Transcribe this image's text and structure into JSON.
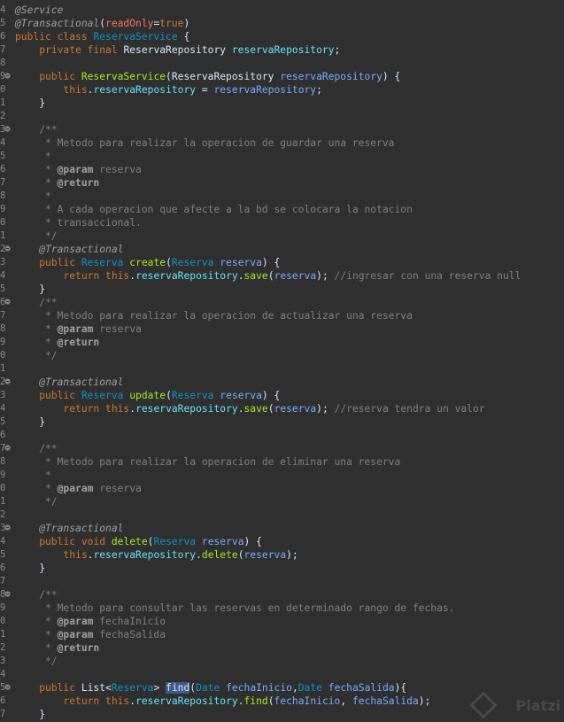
{
  "editor": {
    "lines": [
      {
        "ln": "4",
        "fold": false,
        "tokens": [
          [
            "ann",
            "@Service"
          ]
        ]
      },
      {
        "ln": "5",
        "fold": false,
        "tokens": [
          [
            "ann",
            "@Transactional"
          ],
          [
            "cls",
            "("
          ],
          [
            "pink",
            "readOnly"
          ],
          [
            "cls",
            "="
          ],
          [
            "kw",
            "true"
          ],
          [
            "cls",
            ")"
          ]
        ]
      },
      {
        "ln": "6",
        "fold": false,
        "tokens": [
          [
            "kw",
            "public class "
          ],
          [
            "type",
            "ReservaService"
          ],
          [
            "cls",
            " {"
          ]
        ]
      },
      {
        "ln": "7",
        "fold": false,
        "tokens": [
          [
            "cls",
            "    "
          ],
          [
            "kw",
            "private final "
          ],
          [
            "cls",
            "ReservaRepository "
          ],
          [
            "field",
            "reservaRepository"
          ],
          [
            "cls",
            ";"
          ]
        ]
      },
      {
        "ln": "8",
        "fold": false,
        "tokens": []
      },
      {
        "ln": "9",
        "fold": true,
        "tokens": [
          [
            "cls",
            "    "
          ],
          [
            "kw",
            "public "
          ],
          [
            "method",
            "ReservaService"
          ],
          [
            "cls",
            "(ReservaRepository "
          ],
          [
            "param",
            "reservaRepository"
          ],
          [
            "cls",
            ") {"
          ]
        ]
      },
      {
        "ln": "0",
        "fold": false,
        "tokens": [
          [
            "cls",
            "        "
          ],
          [
            "this",
            "this"
          ],
          [
            "cls",
            "."
          ],
          [
            "field",
            "reservaRepository"
          ],
          [
            "cls",
            " = "
          ],
          [
            "param",
            "reservaRepository"
          ],
          [
            "cls",
            ";"
          ]
        ]
      },
      {
        "ln": "1",
        "fold": false,
        "tokens": [
          [
            "cls",
            "    }"
          ]
        ]
      },
      {
        "ln": "2",
        "fold": false,
        "tokens": []
      },
      {
        "ln": "3",
        "fold": true,
        "tokens": [
          [
            "cmt",
            "    /**"
          ]
        ]
      },
      {
        "ln": "4",
        "fold": false,
        "tokens": [
          [
            "cmt",
            "     * Metodo para realizar la operacion de guardar una reserva"
          ]
        ]
      },
      {
        "ln": "5",
        "fold": false,
        "tokens": [
          [
            "cmt",
            "     *"
          ]
        ]
      },
      {
        "ln": "6",
        "fold": false,
        "tokens": [
          [
            "cmt",
            "     * "
          ],
          [
            "jdtag",
            "@param"
          ],
          [
            "cmt",
            " reserva"
          ]
        ]
      },
      {
        "ln": "7",
        "fold": false,
        "tokens": [
          [
            "cmt",
            "     * "
          ],
          [
            "jdtag",
            "@return"
          ]
        ]
      },
      {
        "ln": "8",
        "fold": false,
        "tokens": [
          [
            "cmt",
            "     *"
          ]
        ]
      },
      {
        "ln": "9",
        "fold": false,
        "tokens": [
          [
            "cmt",
            "     * A cada operacion que afecte a la bd se colocara la notacion"
          ]
        ]
      },
      {
        "ln": "0",
        "fold": false,
        "tokens": [
          [
            "cmt",
            "     * transaccional."
          ]
        ]
      },
      {
        "ln": "1",
        "fold": false,
        "tokens": [
          [
            "cmt",
            "     */"
          ]
        ]
      },
      {
        "ln": "2",
        "fold": true,
        "tokens": [
          [
            "cls",
            "    "
          ],
          [
            "ann",
            "@Transactional"
          ]
        ]
      },
      {
        "ln": "3",
        "fold": false,
        "tokens": [
          [
            "cls",
            "    "
          ],
          [
            "kw",
            "public "
          ],
          [
            "type",
            "Reserva "
          ],
          [
            "method",
            "create"
          ],
          [
            "cls",
            "("
          ],
          [
            "type",
            "Reserva "
          ],
          [
            "param",
            "reserva"
          ],
          [
            "cls",
            ") {"
          ]
        ]
      },
      {
        "ln": "4",
        "fold": false,
        "tokens": [
          [
            "cls",
            "        "
          ],
          [
            "kw",
            "return "
          ],
          [
            "this",
            "this"
          ],
          [
            "cls",
            "."
          ],
          [
            "field",
            "reservaRepository"
          ],
          [
            "cls",
            "."
          ],
          [
            "method",
            "save"
          ],
          [
            "cls",
            "("
          ],
          [
            "param",
            "reserva"
          ],
          [
            "cls",
            "); "
          ],
          [
            "cmt",
            "//ingresar con una reserva null"
          ]
        ]
      },
      {
        "ln": "5",
        "fold": false,
        "tokens": [
          [
            "cls",
            "    }"
          ]
        ]
      },
      {
        "ln": "6",
        "fold": true,
        "tokens": [
          [
            "cmt",
            "    /**"
          ]
        ]
      },
      {
        "ln": "7",
        "fold": false,
        "tokens": [
          [
            "cmt",
            "     * Metodo para realizar la operacion de actualizar una reserva"
          ]
        ]
      },
      {
        "ln": "8",
        "fold": false,
        "tokens": [
          [
            "cmt",
            "     * "
          ],
          [
            "jdtag",
            "@param"
          ],
          [
            "cmt",
            " reserva"
          ]
        ]
      },
      {
        "ln": "9",
        "fold": false,
        "tokens": [
          [
            "cmt",
            "     * "
          ],
          [
            "jdtag",
            "@return"
          ]
        ]
      },
      {
        "ln": "0",
        "fold": false,
        "tokens": [
          [
            "cmt",
            "     */"
          ]
        ]
      },
      {
        "ln": "1",
        "fold": false,
        "tokens": []
      },
      {
        "ln": "2",
        "fold": true,
        "tokens": [
          [
            "cls",
            "    "
          ],
          [
            "ann",
            "@Transactional"
          ]
        ]
      },
      {
        "ln": "3",
        "fold": false,
        "tokens": [
          [
            "cls",
            "    "
          ],
          [
            "kw",
            "public "
          ],
          [
            "type",
            "Reserva "
          ],
          [
            "method",
            "update"
          ],
          [
            "cls",
            "("
          ],
          [
            "type",
            "Reserva "
          ],
          [
            "param",
            "reserva"
          ],
          [
            "cls",
            ") {"
          ]
        ]
      },
      {
        "ln": "4",
        "fold": false,
        "tokens": [
          [
            "cls",
            "        "
          ],
          [
            "kw",
            "return "
          ],
          [
            "this",
            "this"
          ],
          [
            "cls",
            "."
          ],
          [
            "field",
            "reservaRepository"
          ],
          [
            "cls",
            "."
          ],
          [
            "method",
            "save"
          ],
          [
            "cls",
            "("
          ],
          [
            "param",
            "reserva"
          ],
          [
            "cls",
            "); "
          ],
          [
            "cmt",
            "//reserva tendra un valor"
          ]
        ]
      },
      {
        "ln": "5",
        "fold": false,
        "tokens": [
          [
            "cls",
            "    }"
          ]
        ]
      },
      {
        "ln": "6",
        "fold": false,
        "tokens": []
      },
      {
        "ln": "7",
        "fold": true,
        "tokens": [
          [
            "cmt",
            "    /**"
          ]
        ]
      },
      {
        "ln": "8",
        "fold": false,
        "tokens": [
          [
            "cmt",
            "     * Metodo para realizar la operacion de eliminar una reserva"
          ]
        ]
      },
      {
        "ln": "9",
        "fold": false,
        "tokens": [
          [
            "cmt",
            "     *"
          ]
        ]
      },
      {
        "ln": "0",
        "fold": false,
        "tokens": [
          [
            "cmt",
            "     * "
          ],
          [
            "jdtag",
            "@param"
          ],
          [
            "cmt",
            " reserva"
          ]
        ]
      },
      {
        "ln": "1",
        "fold": false,
        "tokens": [
          [
            "cmt",
            "     */"
          ]
        ]
      },
      {
        "ln": "2",
        "fold": false,
        "tokens": []
      },
      {
        "ln": "3",
        "fold": true,
        "tokens": [
          [
            "cls",
            "    "
          ],
          [
            "ann",
            "@Transactional"
          ]
        ]
      },
      {
        "ln": "4",
        "fold": false,
        "tokens": [
          [
            "cls",
            "    "
          ],
          [
            "kw",
            "public void "
          ],
          [
            "method",
            "delete"
          ],
          [
            "cls",
            "("
          ],
          [
            "type",
            "Reserva "
          ],
          [
            "param",
            "reserva"
          ],
          [
            "cls",
            ") {"
          ]
        ]
      },
      {
        "ln": "5",
        "fold": false,
        "tokens": [
          [
            "cls",
            "        "
          ],
          [
            "this",
            "this"
          ],
          [
            "cls",
            "."
          ],
          [
            "field",
            "reservaRepository"
          ],
          [
            "cls",
            "."
          ],
          [
            "method",
            "delete"
          ],
          [
            "cls",
            "("
          ],
          [
            "param",
            "reserva"
          ],
          [
            "cls",
            ");"
          ]
        ]
      },
      {
        "ln": "6",
        "fold": false,
        "tokens": [
          [
            "cls",
            "    }"
          ]
        ]
      },
      {
        "ln": "7",
        "fold": false,
        "tokens": []
      },
      {
        "ln": "8",
        "fold": true,
        "tokens": [
          [
            "cmt",
            "    /**"
          ]
        ]
      },
      {
        "ln": "9",
        "fold": false,
        "tokens": [
          [
            "cmt",
            "     * Metodo para consultar las reservas en determinado rango de fechas."
          ]
        ]
      },
      {
        "ln": "0",
        "fold": false,
        "tokens": [
          [
            "cmt",
            "     * "
          ],
          [
            "jdtag",
            "@param"
          ],
          [
            "cmt",
            " fechaInicio"
          ]
        ]
      },
      {
        "ln": "1",
        "fold": false,
        "tokens": [
          [
            "cmt",
            "     * "
          ],
          [
            "jdtag",
            "@param"
          ],
          [
            "cmt",
            " fechaSalida"
          ]
        ]
      },
      {
        "ln": "2",
        "fold": false,
        "tokens": [
          [
            "cmt",
            "     * "
          ],
          [
            "jdtag",
            "@return"
          ]
        ]
      },
      {
        "ln": "3",
        "fold": false,
        "tokens": [
          [
            "cmt",
            "     */"
          ]
        ]
      },
      {
        "ln": "4",
        "fold": false,
        "tokens": []
      },
      {
        "ln": "5",
        "fold": true,
        "tokens": [
          [
            "cls",
            "    "
          ],
          [
            "kw",
            "public "
          ],
          [
            "cls",
            "List<"
          ],
          [
            "type",
            "Reserva"
          ],
          [
            "cls",
            "> "
          ],
          [
            "hl",
            "find"
          ],
          [
            "cls",
            "("
          ],
          [
            "type",
            "Date "
          ],
          [
            "param",
            "fechaInicio"
          ],
          [
            "cls",
            ","
          ],
          [
            "type",
            "Date "
          ],
          [
            "param",
            "fechaSalida"
          ],
          [
            "cls",
            "){"
          ]
        ]
      },
      {
        "ln": "6",
        "fold": false,
        "tokens": [
          [
            "cls",
            "        "
          ],
          [
            "kw",
            "return "
          ],
          [
            "this",
            "this"
          ],
          [
            "cls",
            "."
          ],
          [
            "field",
            "reservaRepository"
          ],
          [
            "cls",
            "."
          ],
          [
            "method",
            "find"
          ],
          [
            "cls",
            "("
          ],
          [
            "param",
            "fechaInicio"
          ],
          [
            "cls",
            ", "
          ],
          [
            "param",
            "fechaSalida"
          ],
          [
            "cls",
            ");"
          ]
        ]
      },
      {
        "ln": "7",
        "fold": false,
        "tokens": [
          [
            "cls",
            "    }"
          ]
        ]
      }
    ]
  },
  "watermark": {
    "text": "Platzi"
  }
}
